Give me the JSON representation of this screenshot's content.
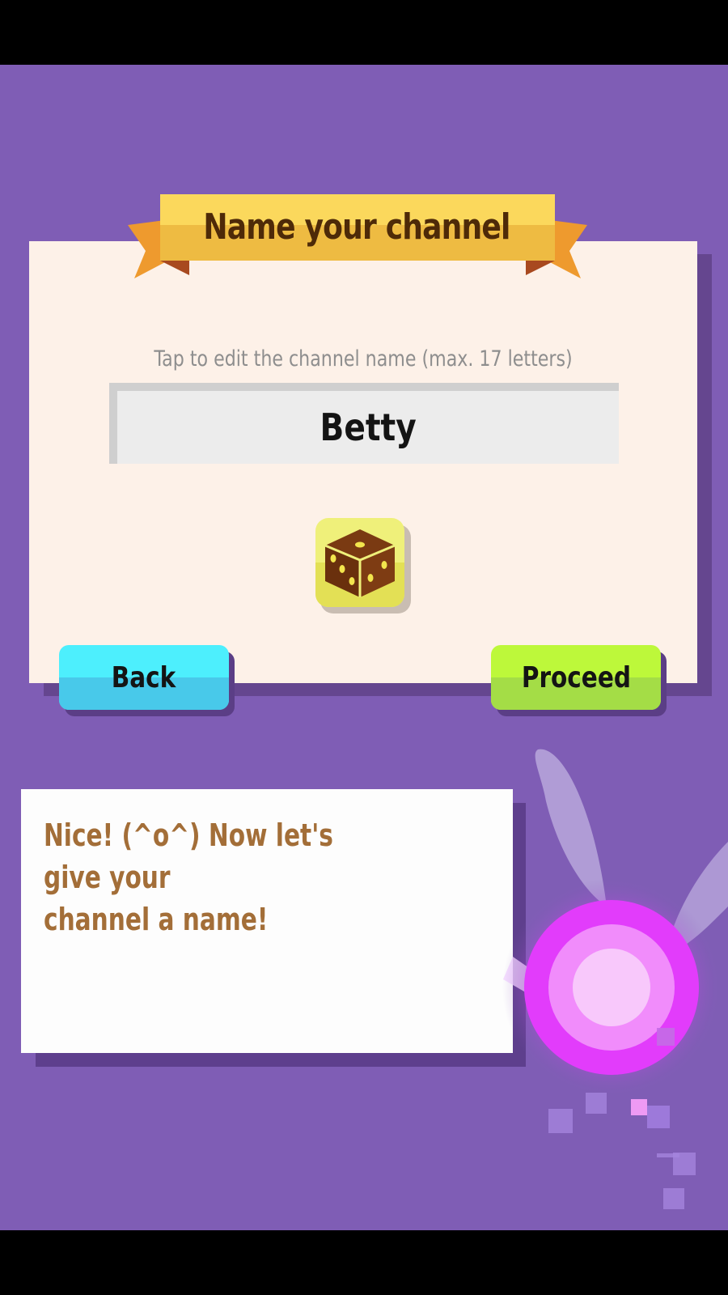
{
  "header": {
    "title": "Name your channel"
  },
  "name_entry": {
    "hint": "Tap to edit the channel name (max. 17 letters)",
    "value": "Betty"
  },
  "buttons": {
    "back": "Back",
    "proceed": "Proceed"
  },
  "dialog": {
    "line1": "Nice! (^o^) Now let's give your",
    "line2": "channel a name!"
  },
  "icons": {
    "randomize": "dice-icon",
    "guide": "fairy-icon"
  },
  "colors": {
    "background": "#7f5db5",
    "panel": "#fdf1e8",
    "ribbon": "#f2c44a",
    "back_button": "#4deffd",
    "proceed_button": "#bdf83a",
    "dialog_text": "#a36e38",
    "fairy_glow": "#e540ff"
  }
}
